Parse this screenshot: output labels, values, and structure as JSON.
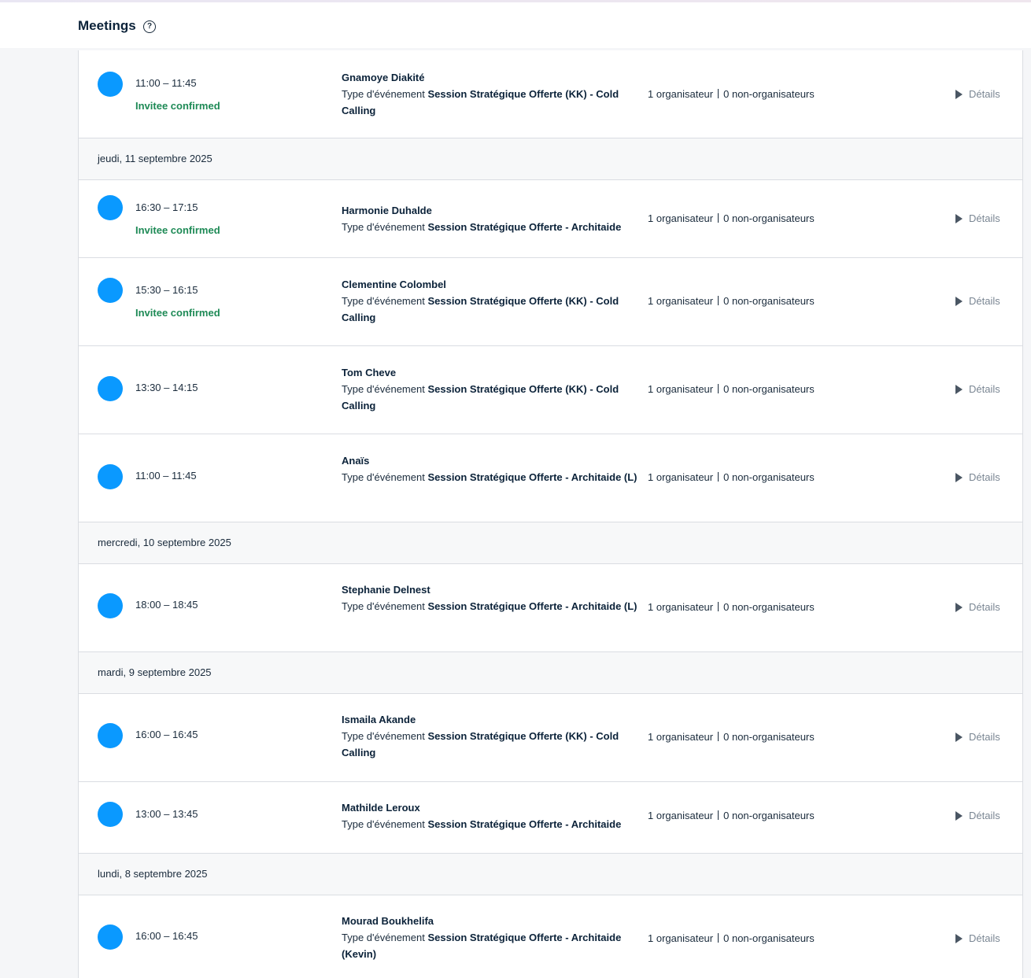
{
  "header": {
    "title": "Meetings",
    "help_icon": "?"
  },
  "common": {
    "event_type_prefix": "Type d'événement",
    "organizers": "1 organisateur",
    "non_organizers": "0 non-organisateurs",
    "details_label": "Détails",
    "accent_color": "#0a99ff",
    "confirmed_color": "#1e8a56"
  },
  "dates": [
    "jeudi, 11 septembre 2025",
    "mercredi, 10 septembre 2025",
    "mardi, 9 septembre 2025",
    "lundi, 8 septembre 2025"
  ],
  "meetings": [
    {
      "time": "11:00 – 11:45",
      "status": "Invitee confirmed",
      "name": "Gnamoye Diakité",
      "event": "Session Stratégique Offerte (KK) - Cold Calling"
    },
    {
      "time": "16:30 – 17:15",
      "status": "Invitee confirmed",
      "name": "Harmonie Duhalde",
      "event": "Session Stratégique Offerte - Architaide"
    },
    {
      "time": "15:30 – 16:15",
      "status": "Invitee confirmed",
      "name": "Clementine Colombel",
      "event": "Session Stratégique Offerte (KK) - Cold Calling"
    },
    {
      "time": "13:30 – 14:15",
      "status": "",
      "name": "Tom Cheve",
      "event": "Session Stratégique Offerte (KK) - Cold Calling"
    },
    {
      "time": "11:00 – 11:45",
      "status": "",
      "name": "Anaïs",
      "event": "Session Stratégique Offerte - Architaide (L)"
    },
    {
      "time": "18:00 – 18:45",
      "status": "",
      "name": "Stephanie Delnest",
      "event": "Session Stratégique Offerte - Architaide (L)"
    },
    {
      "time": "16:00 – 16:45",
      "status": "",
      "name": "Ismaila Akande",
      "event": "Session Stratégique Offerte (KK) - Cold Calling"
    },
    {
      "time": "13:00 – 13:45",
      "status": "",
      "name": "Mathilde Leroux",
      "event": "Session Stratégique Offerte - Architaide"
    },
    {
      "time": "16:00 – 16:45",
      "status": "",
      "name": "Mourad Boukhelifa",
      "event": "Session Stratégique Offerte - Architaide (Kevin)"
    }
  ]
}
